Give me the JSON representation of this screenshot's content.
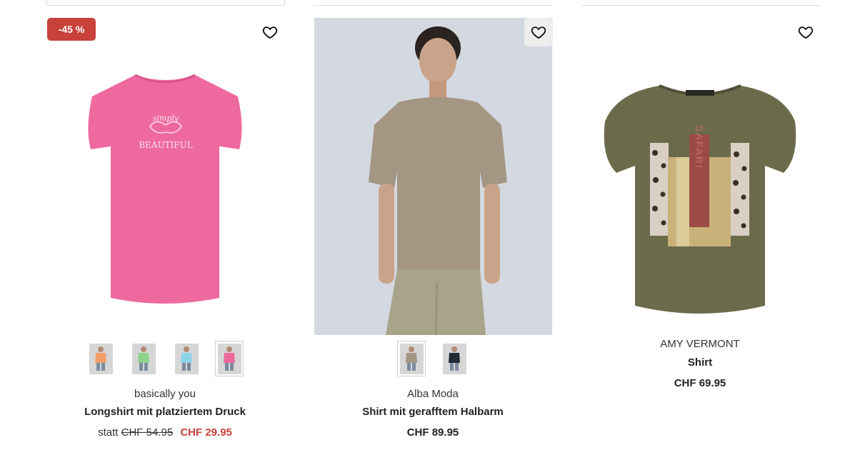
{
  "products": [
    {
      "badge": "-45 %",
      "brand": "basically you",
      "title": "Longshirt mit platziertem Druck",
      "price_prefix": "statt",
      "price_old": "CHF 54.95",
      "price_sale": "CHF 29.95",
      "print_line1": "simply",
      "print_line2": "BEAUTIFUL",
      "shirt_color": "#ee6a9e",
      "swatches": [
        {
          "color": "#f2a068",
          "selected": false
        },
        {
          "color": "#8ed38b",
          "selected": false
        },
        {
          "color": "#8fd3e6",
          "selected": false
        },
        {
          "color": "#ee6a9e",
          "selected": true
        }
      ]
    },
    {
      "brand": "Alba Moda",
      "title": "Shirt mit gerafftem Halbarm",
      "price": "CHF 89.95",
      "shirt_color": "#a39683",
      "swatches": [
        {
          "color": "#a39683",
          "selected": true
        },
        {
          "color": "#1f2a33",
          "selected": false
        }
      ]
    },
    {
      "brand": "AMY VERMONT",
      "title": "Shirt",
      "price": "CHF 69.95",
      "print_text": "SAFARI",
      "shirt_color": "#6b6b4c"
    }
  ],
  "colors": {
    "sale_red": "#c9413b"
  }
}
